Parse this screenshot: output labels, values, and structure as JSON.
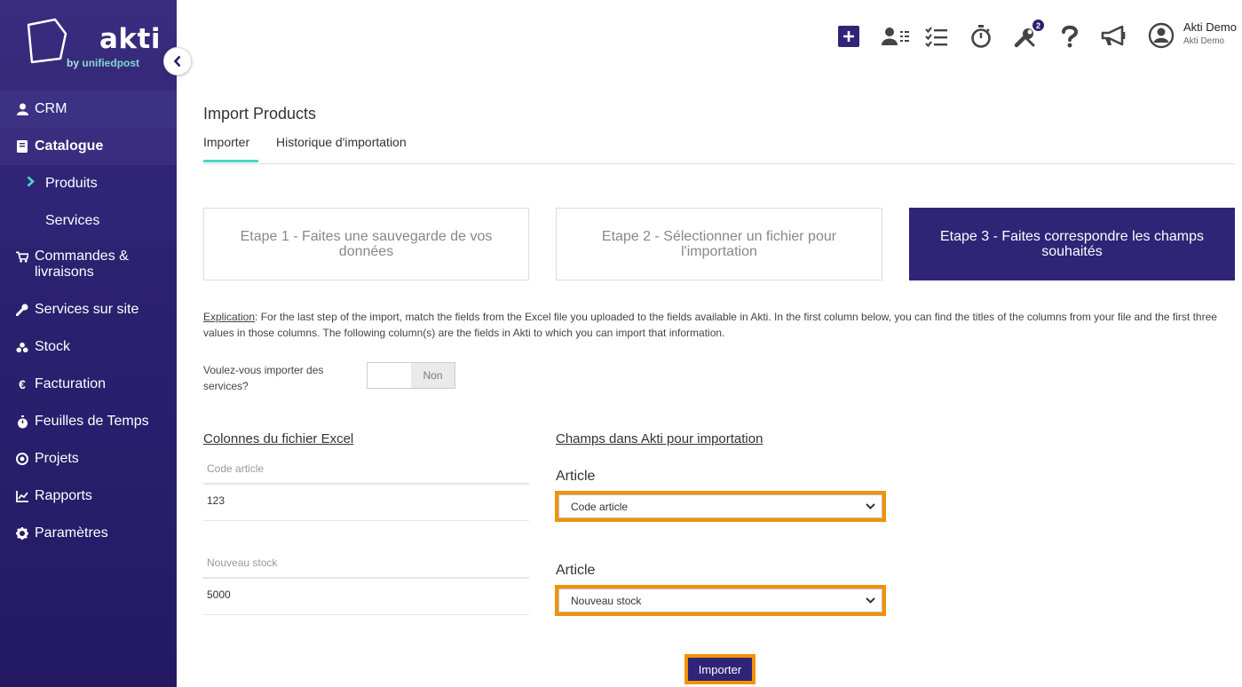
{
  "brand": {
    "name": "akti",
    "tagline_prefix": "by",
    "tagline_company": "unifiedpost"
  },
  "sidebar": {
    "items": [
      {
        "label": "CRM",
        "icon": "user-icon"
      },
      {
        "label": "Catalogue",
        "icon": "book-icon"
      },
      {
        "label": "Produits",
        "icon": "chevron-right-icon"
      },
      {
        "label": "Services"
      },
      {
        "label": "Commandes & livraisons",
        "icon": "cart-icon"
      },
      {
        "label": "Services sur site",
        "icon": "wrench-icon"
      },
      {
        "label": "Stock",
        "icon": "boxes-icon"
      },
      {
        "label": "Facturation",
        "icon": "euro-icon"
      },
      {
        "label": "Feuilles de Temps",
        "icon": "stopwatch-icon"
      },
      {
        "label": "Projets",
        "icon": "target-icon"
      },
      {
        "label": "Rapports",
        "icon": "chart-icon"
      },
      {
        "label": "Paramètres",
        "icon": "gear-icon"
      }
    ]
  },
  "topbar": {
    "icons": [
      "plus-icon",
      "contacts-list-icon",
      "task-list-icon",
      "stopwatch-icon",
      "tools-icon",
      "help-icon",
      "megaphone-icon",
      "user-circle-icon"
    ],
    "tools_badge": "2",
    "user_name": "Akti Demo",
    "user_org": "Akti Demo"
  },
  "page": {
    "title": "Import Products",
    "tabs": [
      {
        "label": "Importer"
      },
      {
        "label": "Historique d'importation"
      }
    ],
    "steps": [
      {
        "label": "Etape 1 - Faites une sauvegarde de vos données"
      },
      {
        "label": "Etape 2 - Sélectionner un fichier pour l'importation"
      },
      {
        "label": "Etape 3 - Faites correspondre les champs souhaités"
      }
    ],
    "explication_label": "Explication",
    "explication_text": ": For the last step of the import, match the fields from the Excel file you uploaded to the fields available in Akti. In the first column below, you can find the titles of the columns from your file and the first three values in those columns. The following column(s) are the fields in Akti to which you can import that information.",
    "toggle_label": "Voulez-vous importer des services?",
    "toggle_value": "Non",
    "excel_columns_heading": "Colonnes du fichier Excel",
    "akti_fields_heading": "Champs dans Akti pour importation",
    "mappings": [
      {
        "column_title": "Code article",
        "first_value": "123",
        "field_label": "Article",
        "selected": "Code article"
      },
      {
        "column_title": "Nouveau stock",
        "first_value": "5000",
        "field_label": "Article",
        "selected": "Nouveau stock"
      }
    ],
    "import_button": "Importer"
  },
  "colors": {
    "sidebar": "#2c2170",
    "accent": "#4dd6c8",
    "highlight": "#f39200",
    "primary": "#2f2476"
  }
}
